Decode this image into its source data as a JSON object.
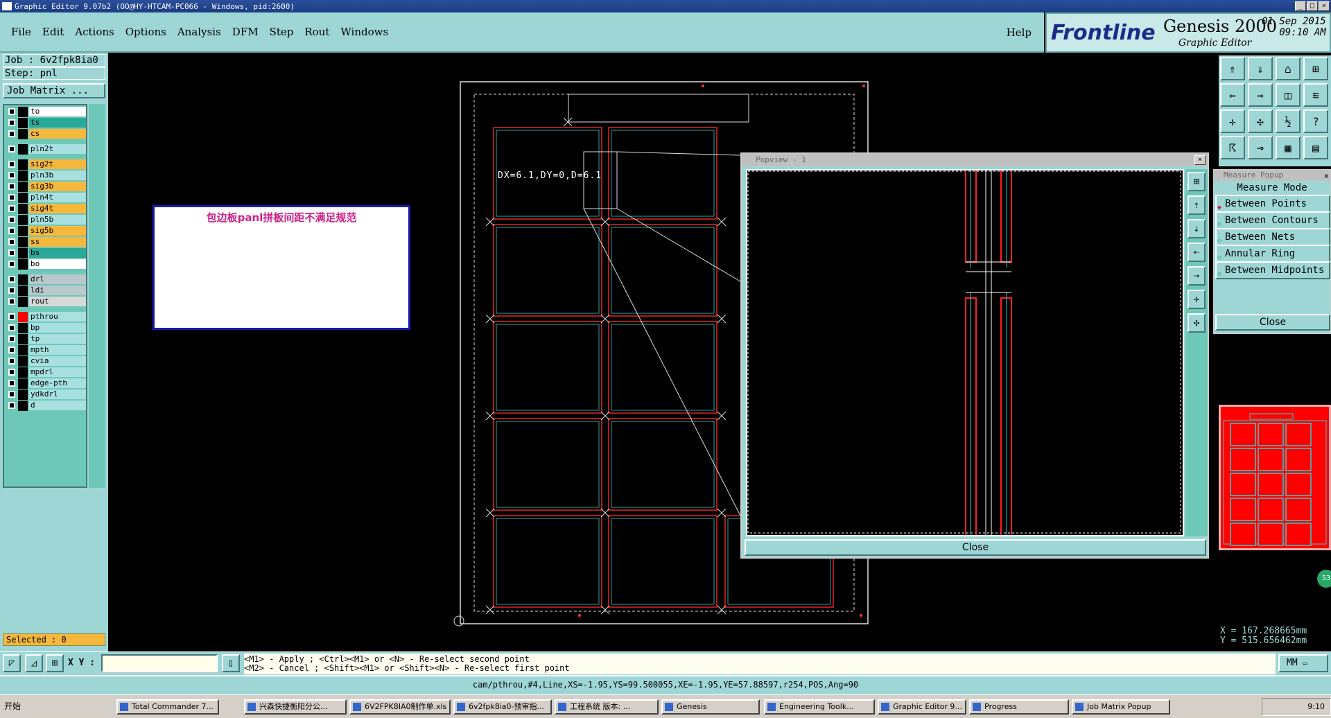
{
  "window": {
    "title": "Graphic Editor 9.07b2 (OO@HY-HTCAM-PC066 - Windows, pid:2600)"
  },
  "menu": {
    "items": [
      "File",
      "Edit",
      "Actions",
      "Options",
      "Analysis",
      "DFM",
      "Step",
      "Rout",
      "Windows"
    ],
    "help": "Help"
  },
  "brand": {
    "logo": "Frontline",
    "product": "Genesis 2000",
    "subtitle": "Graphic Editor",
    "date": "01 Sep 2015",
    "time": "09:10 AM"
  },
  "job": {
    "job_line": "Job : 6v2fpk8ia0",
    "step_line": "Step: pnl",
    "job_matrix": "Job Matrix ..."
  },
  "layers": [
    {
      "name": "to",
      "color": "#ffffff"
    },
    {
      "name": "ts",
      "color": "#2aa898"
    },
    {
      "name": "cs",
      "color": "#f5b83d"
    },
    {
      "name": "pln2t",
      "color": "#a8e0e0"
    },
    {
      "name": "sig2t",
      "color": "#f5b83d"
    },
    {
      "name": "pln3b",
      "color": "#a8e0e0"
    },
    {
      "name": "sig3b",
      "color": "#f5b83d"
    },
    {
      "name": "pln4t",
      "color": "#a8e0e0"
    },
    {
      "name": "sig4t",
      "color": "#f5b83d"
    },
    {
      "name": "pln5b",
      "color": "#a8e0e0"
    },
    {
      "name": "sig5b",
      "color": "#f5b83d"
    },
    {
      "name": "ss",
      "color": "#f5b83d"
    },
    {
      "name": "bs",
      "color": "#2aa898"
    },
    {
      "name": "bo",
      "color": "#ffffff"
    },
    {
      "name": "drl",
      "color": "#b8c8cc"
    },
    {
      "name": "ldi",
      "color": "#b8c8cc"
    },
    {
      "name": "rout",
      "color": "#d8d8d8"
    },
    {
      "name": "pthrou",
      "color": "#a8e0e0"
    },
    {
      "name": "bp",
      "color": "#a8e0e0"
    },
    {
      "name": "tp",
      "color": "#a8e0e0"
    },
    {
      "name": "mpth",
      "color": "#a8e0e0"
    },
    {
      "name": "cvia",
      "color": "#a8e0e0"
    },
    {
      "name": "mpdrl",
      "color": "#a8e0e0"
    },
    {
      "name": "edge-pth",
      "color": "#a8e0e0"
    },
    {
      "name": "ydkdrl",
      "color": "#a8e0e0"
    },
    {
      "name": "d",
      "color": "#a8e0e0"
    }
  ],
  "selected": "Selected : 0",
  "note": "包边板panl拼板间距不满足规范",
  "measure_result": "DX=6.1,DY=0,D=6.1",
  "popview": {
    "title": "Popview - 1",
    "close": "Close"
  },
  "measure_popup": {
    "title": "Measure Popup",
    "heading": "Measure Mode",
    "options": [
      "Between Points",
      "Between Contours",
      "Between Nets",
      "Annular Ring",
      "Between Midpoints"
    ],
    "selected_option": "Between Points",
    "close": "Close"
  },
  "minimap_badge": "53",
  "coords": {
    "x": "X = 167.268665mm",
    "y": "Y = 515.656462mm"
  },
  "bottom": {
    "xy_label": "X Y :",
    "hint_line1": "<M1> - Apply  ; <Ctrl><M1> or <N> - Re-select second point",
    "hint_line2": "<M2> - Cancel ; <Shift><M1> or <Shift><N> - Re-select first point",
    "unit": "MM"
  },
  "status": "cam/pthrou,#4,Line,XS=-1.95,YS=99.500055,XE=-1.95,YE=57.88597,r254,POS,Ang=90",
  "taskbar": {
    "start": "开始",
    "tasks": [
      "Total Commander 7...",
      "兴森快捷衡阳分公...",
      "6V2FPK8IA0制作单.xls",
      "6v2fpk8ia0-预审指...",
      "工程系统  版本: ...",
      "Genesis",
      "Engineering Toolk...",
      "Graphic Editor 9...",
      "Progress",
      "Job Matrix Popup"
    ],
    "clock": "9:10"
  }
}
